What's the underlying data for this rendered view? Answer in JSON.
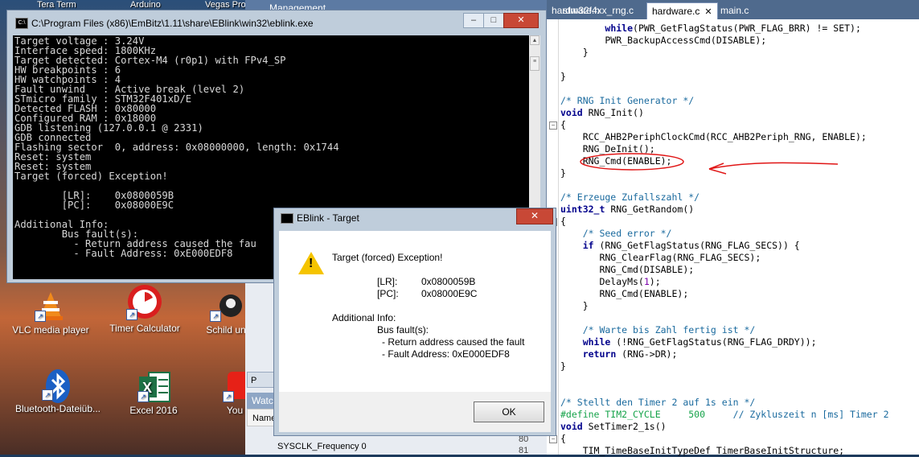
{
  "desktop": {
    "top_labels": [
      "Tera Term",
      "Arduino",
      "Vegas Pro"
    ],
    "icons": [
      {
        "label": "VLC media player",
        "icon": "vlc-cone-icon"
      },
      {
        "label": "Timer Calculator",
        "icon": "timer-calculator-icon"
      },
      {
        "label": "Schild un",
        "icon": "app-icon"
      },
      {
        "label": "Bluetooth-Dateiüb...",
        "icon": "bluetooth-icon"
      },
      {
        "label": "Excel 2016",
        "icon": "excel-icon"
      },
      {
        "label": "You",
        "icon": "youtube-icon"
      }
    ]
  },
  "mid": {
    "management": "Management",
    "watch_tab": "Watch",
    "name_col": "Name",
    "row1": "SYSCLK_Frequency  0",
    "line_numbers": [
      "80",
      "81"
    ],
    "partial_p": "P"
  },
  "console": {
    "title": "C:\\Program Files (x86)\\EmBitz\\1.11\\share\\EBlink\\win32\\eblink.exe",
    "lines": [
      "Target voltage : 3.24V",
      "Interface speed: 1800KHz",
      "Target detected: Cortex-M4 (r0p1) with FPv4_SP",
      "HW breakpoints : 6",
      "HW watchpoints : 4",
      "Fault unwind   : Active break (level 2)",
      "STmicro family : STM32F401xD/E",
      "Detected FLASH : 0x80000",
      "Configured RAM : 0x18000",
      "GDB listening (127.0.0.1 @ 2331)",
      "GDB connected",
      "Flashing sector  0, address: 0x08000000, length: 0x1744",
      "Reset: system",
      "Reset: system",
      "Target (forced) Exception!",
      "",
      "        [LR]:    0x0800059B",
      "        [PC]:    0x08000E9C",
      "",
      "Additional Info:",
      "        Bus fault(s):",
      "          - Return address caused the fau",
      "          - Fault Address: 0xE000EDF8"
    ],
    "btn_min": "–",
    "btn_max": "□",
    "btn_close": "✕"
  },
  "dialog": {
    "title": "EBlink - Target",
    "heading": "Target (forced) Exception!",
    "lr_label": "[LR]:",
    "lr_value": "0x0800059B",
    "pc_label": "[PC]:",
    "pc_value": "0x08000E9C",
    "additional": "Additional Info:",
    "bus_fault": "Bus fault(s):",
    "item1": "- Return address caused the fault",
    "item2": "- Fault Address: 0xE000EDF8",
    "ok": "OK",
    "close": "✕"
  },
  "ide": {
    "tabs": [
      {
        "label": "hardware.h",
        "active": false
      },
      {
        "label": "stm32f4xx_rng.c",
        "active": false
      },
      {
        "label": "hardware.c",
        "active": true
      },
      {
        "label": "main.c",
        "active": false
      }
    ],
    "tab_close": "✕",
    "code": [
      "        while(PWR_GetFlagStatus(PWR_FLAG_BRR) != SET);",
      "        PWR_BackupAccessCmd(DISABLE);",
      "    }",
      "",
      "}",
      "",
      "/* RNG Init Generator */",
      "void RNG_Init()",
      "{",
      "    RCC_AHB2PeriphClockCmd(RCC_AHB2Periph_RNG, ENABLE);",
      "    RNG_DeInit();",
      "    RNG_Cmd(ENABLE);",
      "}",
      "",
      "/* Erzeuge Zufallszahl */",
      "uint32_t RNG_GetRandom()",
      "{",
      "    /* Seed error */",
      "    if (RNG_GetFlagStatus(RNG_FLAG_SECS)) {",
      "       RNG_ClearFlag(RNG_FLAG_SECS);",
      "       RNG_Cmd(DISABLE);",
      "       DelayMs(1);",
      "       RNG_Cmd(ENABLE);",
      "    }",
      "",
      "    /* Warte bis Zahl fertig ist */",
      "    while (!RNG_GetFlagStatus(RNG_FLAG_DRDY));",
      "    return (RNG->DR);",
      "}",
      "",
      "",
      "/* Stellt den Timer 2 auf 1s ein */",
      "#define TIM2_CYCLE     500     // Zykluszeit n [ms] Timer 2",
      "void SetTimer2_1s()",
      "{",
      "    TIM_TimeBaseInitTypeDef TimerBaseInitStructure;"
    ]
  },
  "colors": {
    "annotation": "#e01515",
    "keyword": "#00008b",
    "comment": "#1a6a9e",
    "preprocessor": "#16a34a"
  }
}
